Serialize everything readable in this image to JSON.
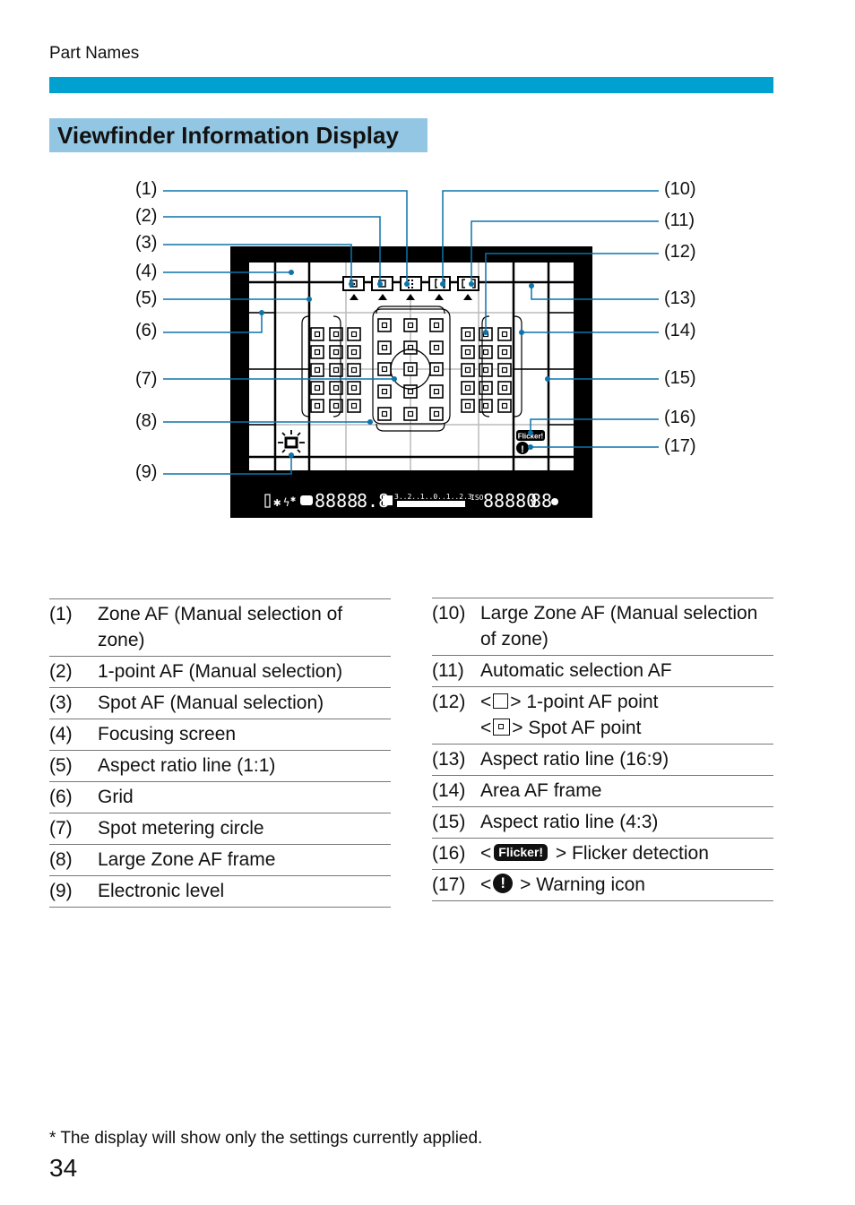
{
  "header": {
    "section": "Part Names",
    "accent_color": "#00a0d0"
  },
  "title": "Viewfinder Information Display",
  "title_bg_color": "#93c6e3",
  "figure": {
    "callouts_left": [
      "(1)",
      "(2)",
      "(3)",
      "(4)",
      "(5)",
      "(6)",
      "(7)",
      "(8)",
      "(9)"
    ],
    "callouts_right": [
      "(10)",
      "(11)",
      "(12)",
      "(13)",
      "(14)",
      "(15)",
      "(16)",
      "(17)"
    ],
    "af_mode_icons": [
      "spot-af-icon",
      "1-point-af-icon",
      "zone-af-icon",
      "large-zone-af-icon",
      "auto-selection-af-icon"
    ],
    "flicker_badge": "Flicker!",
    "warning_glyph": "!",
    "lcd_readout": {
      "shutter": "8888",
      "aperture": "8.8",
      "exposure_scale": "3..2..1..0..1..2.3",
      "iso_label": "ISO",
      "iso_value": "88880",
      "shots": "88"
    }
  },
  "items_left": [
    {
      "num": "(1)",
      "desc": "Zone AF (Manual selection of zone)"
    },
    {
      "num": "(2)",
      "desc": "1-point AF (Manual selection)"
    },
    {
      "num": "(3)",
      "desc": "Spot AF (Manual selection)"
    },
    {
      "num": "(4)",
      "desc": "Focusing screen"
    },
    {
      "num": "(5)",
      "desc": "Aspect ratio line (1:1)"
    },
    {
      "num": "(6)",
      "desc": "Grid"
    },
    {
      "num": "(7)",
      "desc": "Spot metering circle"
    },
    {
      "num": "(8)",
      "desc": "Large Zone AF frame"
    },
    {
      "num": "(9)",
      "desc": "Electronic level"
    }
  ],
  "items_right": [
    {
      "num": "(10)",
      "desc": "Large Zone AF (Manual selection of zone)"
    },
    {
      "num": "(11)",
      "desc": "Automatic selection AF"
    },
    {
      "num": "(12)",
      "line1": "> 1-point AF point",
      "line2": "> Spot AF point"
    },
    {
      "num": "(13)",
      "desc": "Aspect ratio line (16:9)"
    },
    {
      "num": "(14)",
      "desc": "Area AF frame"
    },
    {
      "num": "(15)",
      "desc": "Aspect ratio line (4:3)"
    },
    {
      "num": "(16)",
      "icon_text": "Flicker!",
      "desc": "> Flicker detection"
    },
    {
      "num": "(17)",
      "icon_text": "!",
      "desc": "> Warning icon"
    }
  ],
  "lt": "<",
  "footnote": "*  The display will show only the settings currently applied.",
  "page_number": "34"
}
